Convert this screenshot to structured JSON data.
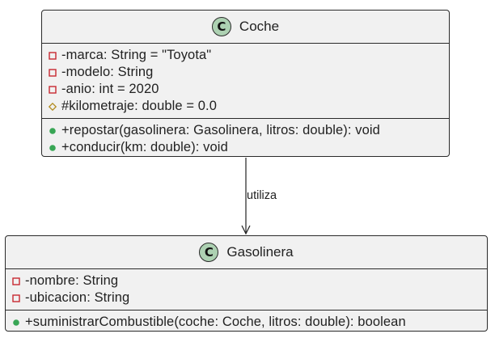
{
  "classes": {
    "coche": {
      "stereotype": "C",
      "name": "Coche",
      "attributes": [
        {
          "visibility": "private",
          "text": "-marca: String = \"Toyota\""
        },
        {
          "visibility": "private",
          "text": "-modelo: String"
        },
        {
          "visibility": "private",
          "text": "-anio: int = 2020"
        },
        {
          "visibility": "protected",
          "text": "#kilometraje: double = 0.0"
        }
      ],
      "methods": [
        {
          "visibility": "public",
          "text": "+repostar(gasolinera: Gasolinera, litros: double): void"
        },
        {
          "visibility": "public",
          "text": "+conducir(km: double): void"
        }
      ]
    },
    "gasolinera": {
      "stereotype": "C",
      "name": "Gasolinera",
      "attributes": [
        {
          "visibility": "private",
          "text": "-nombre: String"
        },
        {
          "visibility": "private",
          "text": "-ubicacion: String"
        }
      ],
      "methods": [
        {
          "visibility": "public",
          "text": "+suministrarCombustible(coche: Coche, litros: double): boolean"
        }
      ]
    }
  },
  "relation": {
    "from": "Coche",
    "to": "Gasolinera",
    "label": "utiliza"
  },
  "colors": {
    "class_fill": "#f1f1f1",
    "class_border": "#2a2a2a",
    "stereotype_fill": "#add1b2",
    "private_icon": "#c82930",
    "protected_icon": "#b38d22",
    "public_icon": "#38a655"
  }
}
